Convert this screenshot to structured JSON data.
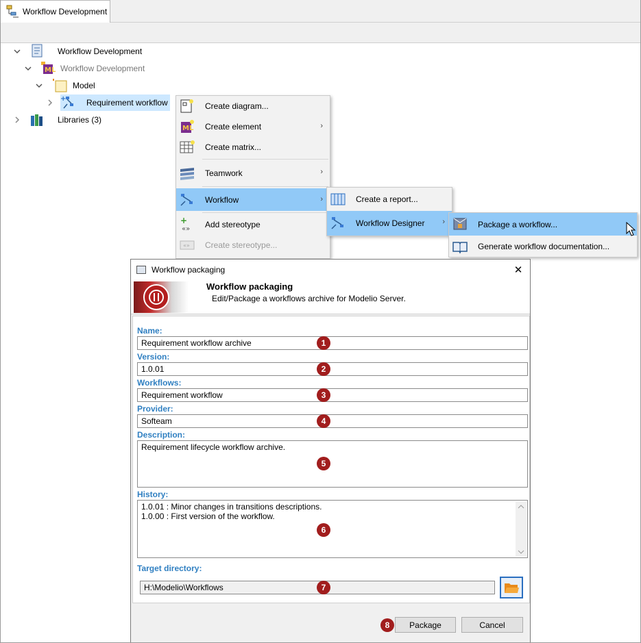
{
  "tab": {
    "title": "Workflow Development"
  },
  "tree": {
    "root": "Workflow Development",
    "project": "Workflow Development",
    "model": "Model",
    "requirement": "Requirement workflow",
    "libraries": "Libraries (3)"
  },
  "context_menu": {
    "items": [
      {
        "label": "Create diagram...",
        "icon": "create-diagram-icon"
      },
      {
        "label": "Create element",
        "icon": "create-element-icon"
      },
      {
        "label": "Create matrix...",
        "icon": "create-matrix-icon"
      },
      {
        "label": "Teamwork",
        "icon": "teamwork-icon"
      },
      {
        "label": "Workflow",
        "icon": "workflow-icon"
      },
      {
        "label": "Add stereotype",
        "icon": "add-stereotype-icon"
      },
      {
        "label": "Create stereotype...",
        "icon": "create-stereotype-icon"
      }
    ]
  },
  "workflow_menu": {
    "items": [
      {
        "label": "Create a report...",
        "icon": "report-icon"
      },
      {
        "label": "Workflow Designer",
        "icon": "workflow-designer-icon"
      }
    ]
  },
  "designer_menu": {
    "items": [
      {
        "label": "Package a workflow...",
        "icon": "package-icon"
      },
      {
        "label": "Generate workflow documentation...",
        "icon": "documentation-icon"
      }
    ]
  },
  "dialog": {
    "window_title": "Workflow packaging",
    "banner_title": "Workflow packaging",
    "banner_subtitle": "Edit/Package a workflows archive for Modelio Server.",
    "labels": {
      "name": "Name:",
      "version": "Version:",
      "workflows": "Workflows:",
      "provider": "Provider:",
      "description": "Description:",
      "history": "History:",
      "target": "Target directory:"
    },
    "values": {
      "name": "Requirement workflow archive",
      "version": "1.0.01",
      "workflows": "Requirement workflow",
      "provider": "Softeam",
      "description": "Requirement lifecycle workflow archive.",
      "history_1": "1.0.01 : Minor changes in transitions descriptions.",
      "history_2": "1.0.00 : First version of the workflow.",
      "target": "H:\\Modelio\\Workflows"
    },
    "buttons": {
      "package": "Package",
      "cancel": "Cancel"
    }
  },
  "badges": [
    "1",
    "2",
    "3",
    "4",
    "5",
    "6",
    "7",
    "8"
  ],
  "colors": {
    "accent_label": "#2f7fc1",
    "badge": "#a11d1d",
    "highlight": "#91c9f7",
    "selection": "#cde8ff"
  }
}
